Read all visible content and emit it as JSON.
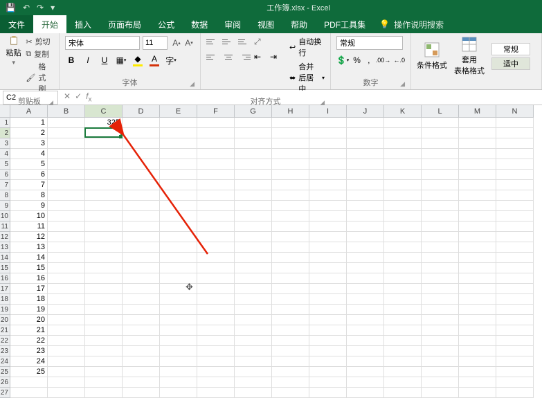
{
  "title": "工作簿.xlsx - Excel",
  "tabs": {
    "file": "文件",
    "home": "开始",
    "insert": "插入",
    "layout": "页面布局",
    "formulas": "公式",
    "data": "数据",
    "review": "审阅",
    "view": "视图",
    "help": "帮助",
    "pdf": "PDF工具集",
    "tellme": "操作说明搜索"
  },
  "ribbon": {
    "clipboard": {
      "paste": "粘贴",
      "cut": "剪切",
      "copy": "复制",
      "painter": "格式刷",
      "group": "剪贴板"
    },
    "font": {
      "name": "宋体",
      "size": "11",
      "group": "字体"
    },
    "align": {
      "wrap": "自动换行",
      "merge": "合并后居中",
      "group": "对齐方式"
    },
    "number": {
      "format": "常规",
      "group": "数字"
    },
    "styles": {
      "cond": "条件格式",
      "table": "套用\n表格格式",
      "normal": "常规",
      "fit": "适中"
    }
  },
  "namebox": "C2",
  "columns": [
    "A",
    "B",
    "C",
    "D",
    "E",
    "F",
    "G",
    "H",
    "I",
    "J",
    "K",
    "L",
    "M",
    "N"
  ],
  "rows_a": [
    "1",
    "2",
    "3",
    "4",
    "5",
    "6",
    "7",
    "8",
    "9",
    "10",
    "11",
    "12",
    "13",
    "14",
    "15",
    "16",
    "17",
    "18",
    "19",
    "20",
    "21",
    "22",
    "23",
    "24",
    "25"
  ],
  "cell_c1": "325",
  "active": {
    "col": "C",
    "row": 2
  }
}
